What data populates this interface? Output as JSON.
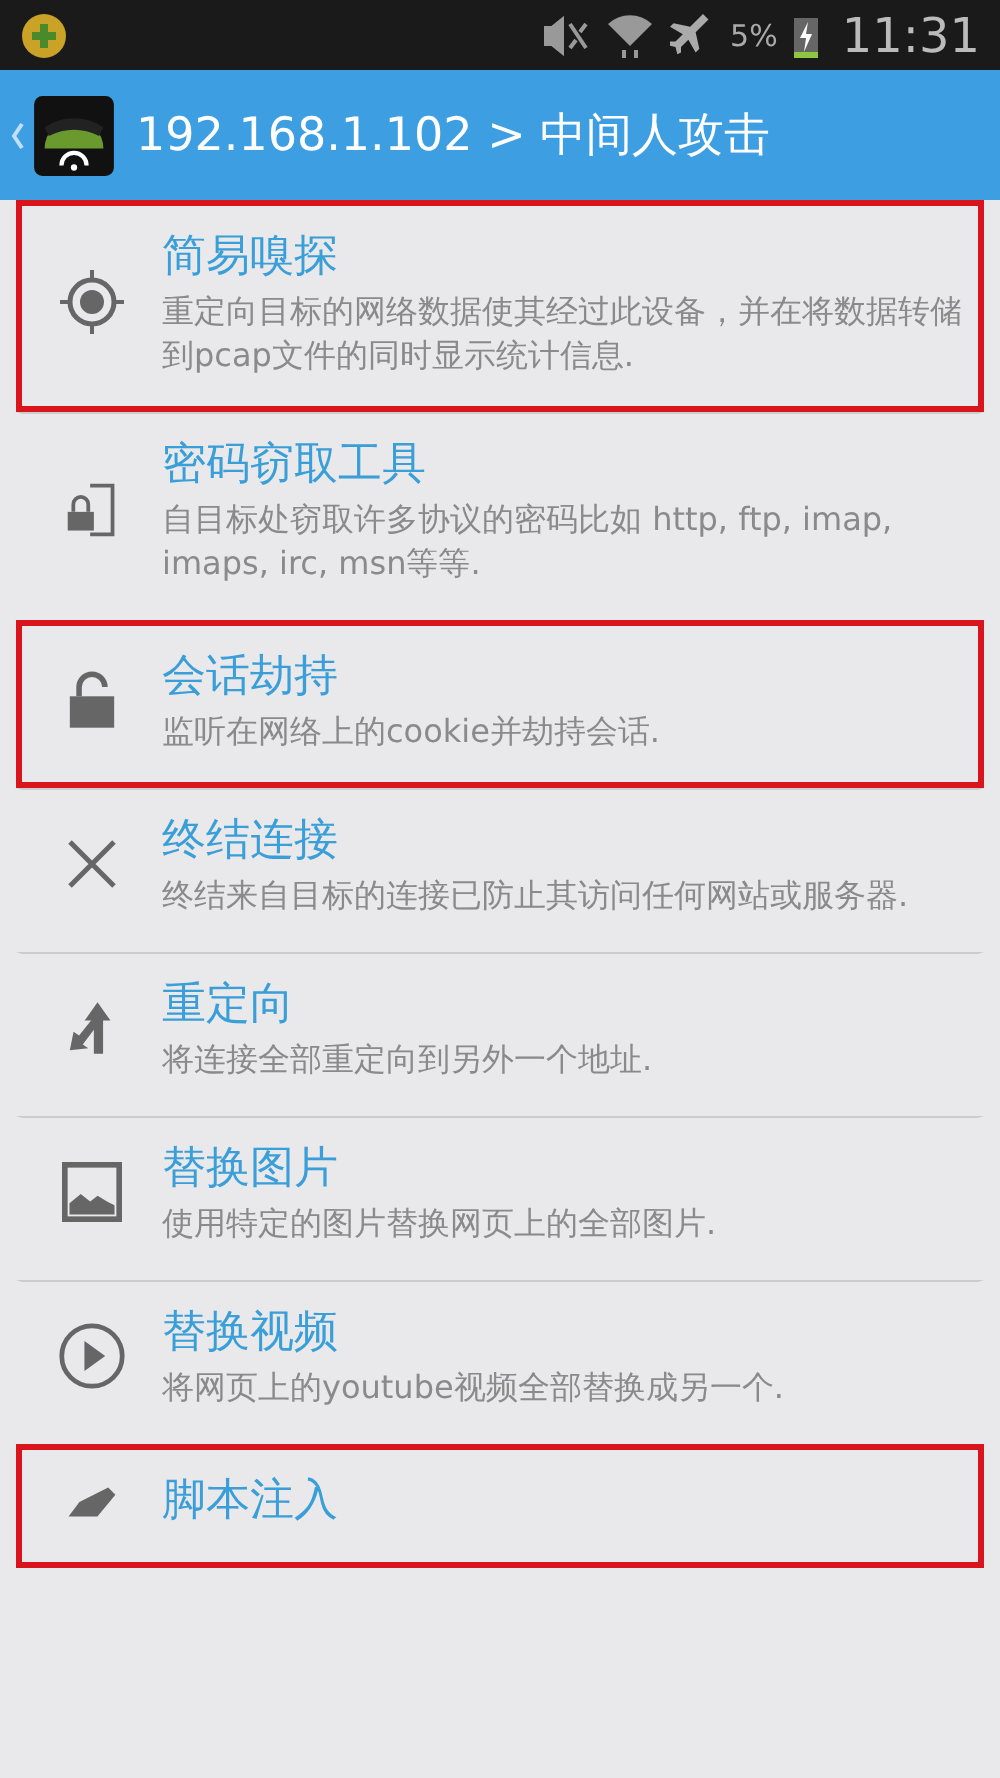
{
  "status_bar": {
    "battery": "5%",
    "time": "11:31"
  },
  "app_bar": {
    "title": "192.168.1.102 > 中间人攻击"
  },
  "items": [
    {
      "kind": "target",
      "title": "简易嗅探",
      "description": "重定向目标的网络数据使其经过此设备，并在将数据转储到pcap文件的同时显示统计信息.",
      "highlighted": true
    },
    {
      "kind": "lock-file",
      "title": "密码窃取工具",
      "description": "自目标处窃取许多协议的密码比如 http, ftp, imap, imaps, irc, msn等等.",
      "highlighted": false
    },
    {
      "kind": "lock",
      "title": "会话劫持",
      "description": "监听在网络上的cookie并劫持会话.",
      "highlighted": true
    },
    {
      "kind": "close",
      "title": "终结连接",
      "description": "终结来自目标的连接已防止其访问任何网站或服务器.",
      "highlighted": false
    },
    {
      "kind": "redirect",
      "title": "重定向",
      "description": "将连接全部重定向到另外一个地址.",
      "highlighted": false
    },
    {
      "kind": "image",
      "title": "替换图片",
      "description": "使用特定的图片替换网页上的全部图片.",
      "highlighted": false
    },
    {
      "kind": "play",
      "title": "替换视频",
      "description": "将网页上的youtube视频全部替换成另一个.",
      "highlighted": false
    },
    {
      "kind": "pen",
      "title": "脚本注入",
      "highlighted": true
    }
  ]
}
